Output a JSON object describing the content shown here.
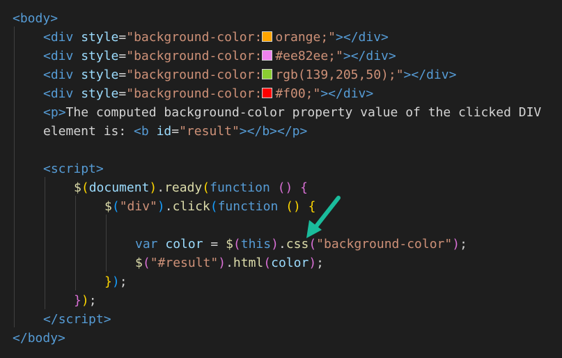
{
  "code": {
    "l1": {
      "open": "<",
      "tag": "body",
      "close": ">"
    },
    "divs": [
      {
        "value": "orange;",
        "swatch": "#ffa500"
      },
      {
        "value": "#ee82ee;",
        "swatch": "#ee82ee"
      },
      {
        "value": "rgb(139,205,50);",
        "swatch": "#8bcd32"
      },
      {
        "value": "#f00;",
        "swatch": "#ff0000"
      }
    ],
    "div_open": "<",
    "div_tag": "div",
    "div_attr": " style",
    "div_eq": "=",
    "div_str_start": "\"background-color:",
    "div_str_end": "\"",
    "div_close_open": "></",
    "div_close_tag": "div",
    "div_close_end": ">",
    "p_line": {
      "open": "<",
      "tag": "p",
      "gt": ">",
      "text": "The computed background-color property value of the clicked DIV"
    },
    "p_line2": {
      "text": "element is: ",
      "b_open": "<",
      "b_tag": "b",
      "b_attr": " id",
      "eq": "=",
      "id_val": "\"result\"",
      "b_mid": "></",
      "b_tag2": "b",
      "mid2": "></",
      "p_tag": "p",
      "end": ">"
    },
    "script_open": {
      "lt": "<",
      "tag": "script",
      "gt": ">"
    },
    "ready_line": {
      "dollar": "$",
      "p_open": "(",
      "document": "document",
      "p_close": ")",
      "dot": ".",
      "ready": "ready",
      "p2_open": "(",
      "function": "function",
      "sp": " ",
      "p3": "()",
      "brace": " {"
    },
    "click_line": {
      "dollar": "$",
      "p_open": "(",
      "sel": "\"div\"",
      "p_close": ")",
      "dot": ".",
      "click": "click",
      "p2_open": "(",
      "function": "function",
      "sp": " ",
      "p3": "()",
      "brace": " {"
    },
    "var_line": {
      "var": "var",
      "sp": " ",
      "color": "color",
      "eq": " = ",
      "dollar": "$",
      "p_open": "(",
      "this": "this",
      "p_close": ")",
      "dot": ".",
      "css": "css",
      "p2_open": "(",
      "arg": "\"background-color\"",
      "p2_close": ")",
      "semi": ";"
    },
    "html_line": {
      "dollar": "$",
      "p_open": "(",
      "sel": "\"#result\"",
      "p_close": ")",
      "dot": ".",
      "html": "html",
      "p2_open": "(",
      "color": "color",
      "p2_close": ")",
      "semi": ";"
    },
    "close_click": {
      "brace": "}",
      "paren": ")",
      "semi": ";"
    },
    "close_ready": {
      "brace": "}",
      "paren": ")",
      "semi": ";"
    },
    "script_close": {
      "lt": "</",
      "tag": "script",
      "gt": ">"
    },
    "body_close": {
      "lt": "</",
      "tag": "body",
      "gt": ">"
    }
  },
  "colors": {
    "background": "#1e1e1e",
    "arrow": "#1abc9c"
  },
  "icons": [
    "arrow-annotation-icon"
  ]
}
